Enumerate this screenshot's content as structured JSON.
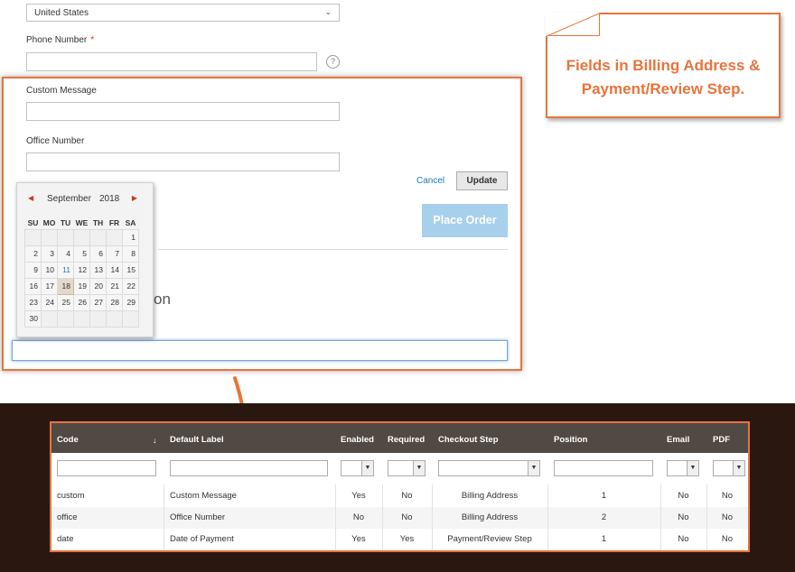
{
  "form": {
    "country_value": "United States",
    "phone_label": "Phone Number",
    "phone_required": "*",
    "help_glyph": "?",
    "custom_message_label": "Custom Message",
    "office_number_label": "Office Number",
    "cancel_label": "Cancel",
    "update_label": "Update",
    "place_order_label": "Place Order",
    "ghost_text": "on"
  },
  "calendar": {
    "prev_glyph": "◀",
    "next_glyph": "▶",
    "month": "September",
    "year": "2018",
    "weekdays": [
      "SU",
      "MO",
      "TU",
      "WE",
      "TH",
      "FR",
      "SA"
    ],
    "weeks": [
      [
        "",
        "",
        "",
        "",
        "",
        "",
        "1"
      ],
      [
        "2",
        "3",
        "4",
        "5",
        "6",
        "7",
        "8"
      ],
      [
        "9",
        "10",
        "11",
        "12",
        "13",
        "14",
        "15"
      ],
      [
        "16",
        "17",
        "18",
        "19",
        "20",
        "21",
        "22"
      ],
      [
        "23",
        "24",
        "25",
        "26",
        "27",
        "28",
        "29"
      ],
      [
        "30",
        "",
        "",
        "",
        "",
        "",
        ""
      ]
    ],
    "today": "18"
  },
  "callout": {
    "line1": "Fields in Billing Address &",
    "line2": "Payment/Review Step."
  },
  "grid": {
    "headers": {
      "code": "Code",
      "sort_glyph": "↓",
      "default_label": "Default Label",
      "enabled": "Enabled",
      "required": "Required",
      "checkout_step": "Checkout Step",
      "position": "Position",
      "email": "Email",
      "pdf": "PDF"
    },
    "select_arrow": "▼",
    "rows": [
      {
        "code": "custom",
        "label": "Custom Message",
        "enabled": "Yes",
        "required": "No",
        "step": "Billing Address",
        "position": "1",
        "email": "No",
        "pdf": "No"
      },
      {
        "code": "office",
        "label": "Office Number",
        "enabled": "No",
        "required": "No",
        "step": "Billing Address",
        "position": "2",
        "email": "No",
        "pdf": "No"
      },
      {
        "code": "date",
        "label": "Date of Payment",
        "enabled": "Yes",
        "required": "Yes",
        "step": "Payment/Review Step",
        "position": "1",
        "email": "No",
        "pdf": "No"
      }
    ]
  },
  "colors": {
    "accent": "#e8743b",
    "link": "#1979c3",
    "place_order_bg": "#a7d0ec",
    "grid_header_bg": "#514943",
    "dark_bg": "#2a1810"
  }
}
